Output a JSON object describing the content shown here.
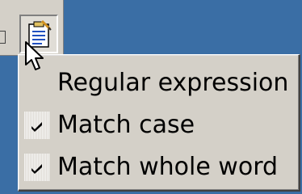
{
  "toolbar": {
    "options_button_icon": "find-options-icon"
  },
  "menu": {
    "items": [
      {
        "label": "Regular expression",
        "checked": false
      },
      {
        "label": "Match case",
        "checked": true
      },
      {
        "label": "Match whole word",
        "checked": true
      }
    ]
  },
  "colors": {
    "desktop": "#3a6ea5",
    "menu_face": "#d4d0c8"
  }
}
